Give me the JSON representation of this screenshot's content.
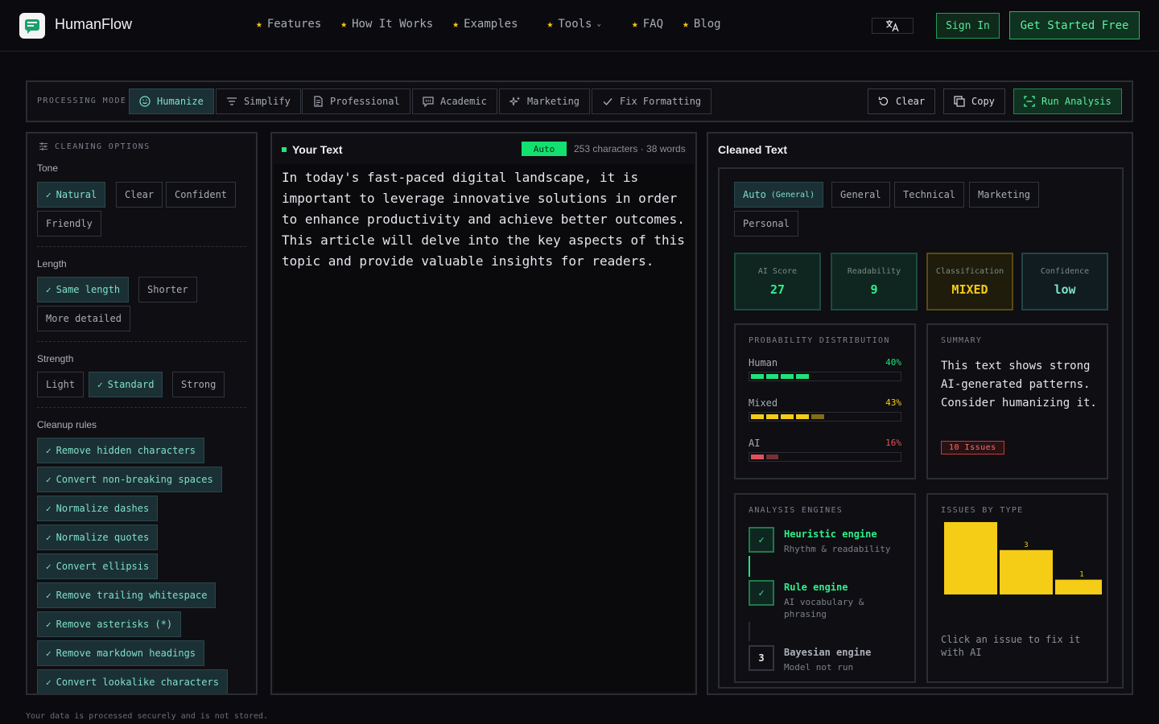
{
  "nav": {
    "brand": "HumanFlow",
    "links": [
      "Features",
      "How It Works",
      "Examples",
      "Tools",
      "FAQ",
      "Blog"
    ],
    "sign_in": "Sign In",
    "get_started": "Get Started Free"
  },
  "modebar": {
    "label": "PROCESSING MODE",
    "modes": [
      "Humanize",
      "Simplify",
      "Professional",
      "Academic",
      "Marketing",
      "Fix Formatting"
    ],
    "active_mode": "Humanize",
    "clear": "Clear",
    "copy": "Copy",
    "run": "Run Analysis"
  },
  "cleaning": {
    "title": "CLEANING OPTIONS",
    "tone_label": "Tone",
    "tone": [
      "Natural",
      "Clear",
      "Confident",
      "Friendly"
    ],
    "length_label": "Length",
    "length": [
      "Same length",
      "Shorter",
      "More detailed"
    ],
    "strength_label": "Strength",
    "strength": [
      "Light",
      "Standard",
      "Strong"
    ],
    "rules_label": "Cleanup rules",
    "rules": [
      "Remove hidden characters",
      "Convert non-breaking spaces",
      "Normalize dashes",
      "Normalize quotes",
      "Convert ellipsis",
      "Remove trailing whitespace",
      "Remove asterisks (*)",
      "Remove markdown headings",
      "Convert lookalike characters"
    ]
  },
  "input": {
    "title": "Your Text",
    "badge": "Auto",
    "count": "253 characters · 38 words",
    "text": "In today's fast-paced digital landscape, it is important to leverage innovative solutions in order to enhance productivity and achieve better outcomes. This article will delve into the key aspects of this topic and provide valuable insights for readers."
  },
  "output": {
    "title": "Cleaned Text",
    "tabs": {
      "auto": "Auto",
      "auto_sub": "(General)",
      "general": "General",
      "technical": "Technical",
      "marketing": "Marketing",
      "personal": "Personal"
    },
    "metrics": {
      "ai_score_label": "AI Score",
      "ai_score": "27",
      "readability_label": "Readability",
      "readability": "9",
      "classification_label": "Classification",
      "classification": "MIXED",
      "confidence_label": "Confidence",
      "confidence": "low"
    },
    "probability": {
      "title": "PROBABILITY DISTRIBUTION",
      "rows": [
        {
          "label": "Human",
          "value": "40%",
          "fraction": 0.4,
          "color": "#1fe37a"
        },
        {
          "label": "Mixed",
          "value": "43%",
          "fraction": 0.43,
          "color": "#f5cc16"
        },
        {
          "label": "AI",
          "value": "16%",
          "fraction": 0.16,
          "color": "#e0525a"
        }
      ]
    },
    "summary": {
      "title": "SUMMARY",
      "text": "This text shows strong AI-generated patterns. Consider humanizing it.",
      "issues": "10 Issues"
    },
    "engines": {
      "title": "ANALYSIS ENGINES",
      "list": [
        {
          "name": "Heuristic engine",
          "sub": "Rhythm & readability",
          "mark": "✓",
          "done": true
        },
        {
          "name": "Rule engine",
          "sub": "AI vocabulary & phrasing",
          "mark": "✓",
          "done": true
        },
        {
          "name": "Bayesian engine",
          "sub": "Model not run",
          "mark": "3",
          "done": false
        }
      ]
    },
    "issues_chart": {
      "title": "ISSUES BY TYPE",
      "hint": "Click an issue to fix it with AI"
    }
  },
  "chart_data": {
    "type": "bar",
    "title": "ISSUES BY TYPE",
    "categories": [],
    "values": [
      5,
      3,
      1
    ],
    "ylim": [
      0,
      5
    ],
    "color": "#f5cc16"
  },
  "footer": "Your data is processed securely and is not stored.",
  "colors": {
    "accent_green": "#1fe37a",
    "accent_teal": "#7ee0c8",
    "accent_yellow": "#f5cc16",
    "accent_red": "#e0525a",
    "background": "#0b0b0f"
  }
}
